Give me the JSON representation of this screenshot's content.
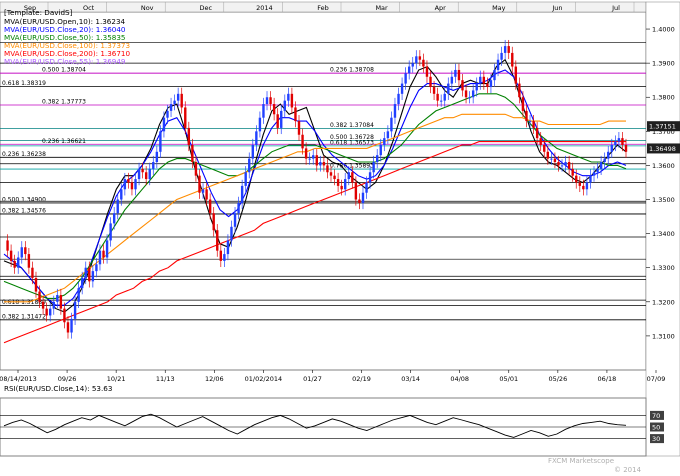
{
  "header": {
    "template": "[Template: DavidS]",
    "indicators": [
      {
        "label": "MVA(EUR/USD.Open,10): 1.36234",
        "color": "#000000"
      },
      {
        "label": "MVA(EUR/USD.Close,20): 1.36040",
        "color": "#0000ff"
      },
      {
        "label": "MVA(EUR/USD.Close,50): 1.35835",
        "color": "#008000"
      },
      {
        "label": "MVA(EUR/USD.Close,100): 1.37373",
        "color": "#ff8c00"
      },
      {
        "label": "MVA(EUR/USD.Close,200): 1.36710",
        "color": "#ff0000"
      },
      {
        "label": "MVA(EUR/USD.Close,55): 1.36949",
        "color": "#c080ff"
      }
    ]
  },
  "chart_data": {
    "type": "line",
    "title": "",
    "instrument": "EUR/USD",
    "top_labels": [
      "Sep",
      "Oct",
      "Nov",
      "Dec",
      "2014",
      "Feb",
      "Mar",
      "Apr",
      "May",
      "Jun",
      "Jul"
    ],
    "x_labels": [
      "08/14/2013",
      "09/26",
      "10/21",
      "11/13",
      "12/06",
      "01/02/2014",
      "01/27",
      "02/19",
      "03/14",
      "04/08",
      "05/01",
      "05/26",
      "06/18",
      "07/09"
    ],
    "ylim": [
      1.3,
      1.405
    ],
    "yticks": [
      "1.4000",
      "1.3900",
      "1.3800",
      "1.3700",
      "1.3600",
      "1.3500",
      "1.3400",
      "1.3300",
      "1.3200",
      "1.3100"
    ],
    "price_series": [
      1.338,
      1.335,
      1.332,
      1.33,
      1.333,
      1.336,
      1.334,
      1.33,
      1.327,
      1.323,
      1.32,
      1.318,
      1.316,
      1.318,
      1.32,
      1.322,
      1.318,
      1.314,
      1.311,
      1.315,
      1.32,
      1.324,
      1.327,
      1.33,
      1.326,
      1.329,
      1.331,
      1.335,
      1.333,
      1.338,
      1.343,
      1.346,
      1.35,
      1.353,
      1.356,
      1.355,
      1.353,
      1.356,
      1.359,
      1.358,
      1.356,
      1.359,
      1.361,
      1.364,
      1.37,
      1.374,
      1.376,
      1.378,
      1.379,
      1.381,
      1.377,
      1.371,
      1.366,
      1.361,
      1.357,
      1.352,
      1.353,
      1.35,
      1.346,
      1.341,
      1.335,
      1.332,
      1.334,
      1.338,
      1.342,
      1.346,
      1.349,
      1.354,
      1.358,
      1.362,
      1.366,
      1.37,
      1.374,
      1.378,
      1.38,
      1.378,
      1.375,
      1.371,
      1.376,
      1.379,
      1.381,
      1.377,
      1.373,
      1.369,
      1.365,
      1.362,
      1.362,
      1.363,
      1.36,
      1.361,
      1.36,
      1.358,
      1.357,
      1.356,
      1.354,
      1.353,
      1.356,
      1.358,
      1.355,
      1.35,
      1.349,
      1.352,
      1.355,
      1.358,
      1.361,
      1.363,
      1.366,
      1.368,
      1.37,
      1.374,
      1.378,
      1.381,
      1.384,
      1.387,
      1.389,
      1.39,
      1.392,
      1.391,
      1.389,
      1.386,
      1.383,
      1.381,
      1.379,
      1.379,
      1.381,
      1.384,
      1.386,
      1.388,
      1.385,
      1.382,
      1.38,
      1.38,
      1.382,
      1.384,
      1.386,
      1.384,
      1.383,
      1.385,
      1.388,
      1.391,
      1.393,
      1.395,
      1.393,
      1.389,
      1.384,
      1.38,
      1.376,
      1.373,
      1.373,
      1.371,
      1.368,
      1.366,
      1.364,
      1.362,
      1.362,
      1.361,
      1.36,
      1.36,
      1.361,
      1.359,
      1.357,
      1.355,
      1.354,
      1.353,
      1.355,
      1.357,
      1.358,
      1.359,
      1.361,
      1.362,
      1.364,
      1.366,
      1.367,
      1.368,
      1.366,
      1.364
    ],
    "series": [
      {
        "name": "MVA(EUR/USD.Open,10)",
        "color": "#000000",
        "values": [
          1.332,
          1.331,
          1.33,
          1.327,
          1.324,
          1.321,
          1.318,
          1.317,
          1.319,
          1.324,
          1.33,
          1.338,
          1.346,
          1.353,
          1.357,
          1.357,
          1.36,
          1.365,
          1.372,
          1.377,
          1.378,
          1.37,
          1.36,
          1.352,
          1.344,
          1.337,
          1.336,
          1.342,
          1.35,
          1.36,
          1.369,
          1.376,
          1.378,
          1.375,
          1.376,
          1.377,
          1.37,
          1.363,
          1.361,
          1.36,
          1.357,
          1.355,
          1.353,
          1.355,
          1.36,
          1.367,
          1.375,
          1.383,
          1.388,
          1.389,
          1.386,
          1.382,
          1.38,
          1.384,
          1.385,
          1.384,
          1.384,
          1.389,
          1.391,
          1.386,
          1.378,
          1.37,
          1.364,
          1.361,
          1.36,
          1.358,
          1.356,
          1.355,
          1.357,
          1.36,
          1.363,
          1.366,
          1.364
        ]
      },
      {
        "name": "MVA(EUR/USD.Close,20)",
        "color": "#0000ff",
        "values": [
          1.334,
          1.332,
          1.33,
          1.327,
          1.324,
          1.321,
          1.319,
          1.319,
          1.321,
          1.325,
          1.331,
          1.338,
          1.345,
          1.351,
          1.355,
          1.357,
          1.36,
          1.364,
          1.369,
          1.373,
          1.374,
          1.37,
          1.364,
          1.358,
          1.352,
          1.347,
          1.345,
          1.347,
          1.352,
          1.359,
          1.366,
          1.371,
          1.374,
          1.374,
          1.373,
          1.373,
          1.37,
          1.366,
          1.363,
          1.361,
          1.359,
          1.357,
          1.356,
          1.357,
          1.36,
          1.365,
          1.371,
          1.377,
          1.382,
          1.384,
          1.384,
          1.383,
          1.382,
          1.383,
          1.384,
          1.384,
          1.385,
          1.387,
          1.388,
          1.386,
          1.381,
          1.375,
          1.369,
          1.365,
          1.362,
          1.36,
          1.358,
          1.357,
          1.357,
          1.358,
          1.36,
          1.361,
          1.36
        ]
      },
      {
        "name": "MVA(EUR/USD.Close,50)",
        "color": "#008000",
        "values": [
          1.326,
          1.325,
          1.324,
          1.323,
          1.322,
          1.321,
          1.321,
          1.322,
          1.324,
          1.327,
          1.331,
          1.335,
          1.339,
          1.343,
          1.347,
          1.35,
          1.353,
          1.356,
          1.359,
          1.361,
          1.362,
          1.362,
          1.361,
          1.36,
          1.359,
          1.358,
          1.357,
          1.357,
          1.358,
          1.36,
          1.362,
          1.364,
          1.365,
          1.366,
          1.366,
          1.366,
          1.366,
          1.365,
          1.364,
          1.363,
          1.362,
          1.361,
          1.361,
          1.361,
          1.362,
          1.364,
          1.366,
          1.369,
          1.372,
          1.374,
          1.376,
          1.377,
          1.378,
          1.379,
          1.38,
          1.381,
          1.381,
          1.381,
          1.38,
          1.378,
          1.375,
          1.372,
          1.369,
          1.367,
          1.365,
          1.364,
          1.363,
          1.362,
          1.361,
          1.361,
          1.36,
          1.36,
          1.359
        ]
      },
      {
        "name": "MVA(EUR/USD.Close,100)",
        "color": "#ff8c00",
        "values": [
          1.32,
          1.32,
          1.32,
          1.32,
          1.321,
          1.322,
          1.323,
          1.324,
          1.326,
          1.328,
          1.33,
          1.332,
          1.334,
          1.336,
          1.338,
          1.34,
          1.342,
          1.344,
          1.346,
          1.348,
          1.35,
          1.351,
          1.352,
          1.353,
          1.354,
          1.355,
          1.356,
          1.357,
          1.358,
          1.359,
          1.36,
          1.361,
          1.362,
          1.363,
          1.364,
          1.364,
          1.365,
          1.365,
          1.365,
          1.365,
          1.365,
          1.365,
          1.365,
          1.366,
          1.367,
          1.368,
          1.369,
          1.37,
          1.371,
          1.372,
          1.373,
          1.374,
          1.374,
          1.375,
          1.375,
          1.375,
          1.375,
          1.375,
          1.375,
          1.374,
          1.374,
          1.373,
          1.373,
          1.372,
          1.372,
          1.372,
          1.372,
          1.372,
          1.372,
          1.372,
          1.373,
          1.373,
          1.373
        ]
      },
      {
        "name": "MVA(EUR/USD.Close,200)",
        "color": "#ff0000",
        "values": [
          1.308,
          1.309,
          1.31,
          1.311,
          1.312,
          1.313,
          1.314,
          1.315,
          1.316,
          1.317,
          1.318,
          1.319,
          1.32,
          1.322,
          1.323,
          1.324,
          1.326,
          1.327,
          1.329,
          1.33,
          1.332,
          1.333,
          1.334,
          1.335,
          1.336,
          1.337,
          1.338,
          1.339,
          1.34,
          1.341,
          1.343,
          1.344,
          1.345,
          1.346,
          1.347,
          1.348,
          1.349,
          1.35,
          1.351,
          1.352,
          1.353,
          1.354,
          1.355,
          1.356,
          1.357,
          1.358,
          1.359,
          1.36,
          1.361,
          1.362,
          1.363,
          1.364,
          1.365,
          1.366,
          1.366,
          1.367,
          1.367,
          1.367,
          1.367,
          1.367,
          1.367,
          1.367,
          1.367,
          1.367,
          1.367,
          1.367,
          1.367,
          1.367,
          1.367,
          1.367,
          1.367,
          1.367,
          1.367
        ]
      }
    ],
    "levels": [
      {
        "label": "0.618 1.38319",
        "value": 1.38319,
        "color": "#000000"
      },
      {
        "label": "0.500 1.38704",
        "value": 1.38704,
        "color": "#c000c0"
      },
      {
        "label": "0.382 1.37773",
        "value": 1.37773,
        "color": "#c000c0"
      },
      {
        "label": "0.236 1.38708",
        "value": 1.38708,
        "color": "#c000c0"
      },
      {
        "label": "0.382 1.37084",
        "value": 1.37084,
        "color": "#008080"
      },
      {
        "label": "0.500 1.36728",
        "value": 1.36728,
        "color": "#008080"
      },
      {
        "label": "0.236 1.36621",
        "value": 1.36621,
        "color": "#c000c0"
      },
      {
        "label": "0.236 1.36238",
        "value": 1.36238,
        "color": "#000000"
      },
      {
        "label": "0.618 1.36573",
        "value": 1.36573,
        "color": "#00a0a0"
      },
      {
        "label": "0.786 1.35893",
        "value": 1.35893,
        "color": "#00a0a0"
      },
      {
        "label": "0.500 1.34900",
        "value": 1.349,
        "color": "#000000"
      },
      {
        "label": "0.382 1.34576",
        "value": 1.34576,
        "color": "#000000"
      },
      {
        "label": "0.618 1.31889",
        "value": 1.31889,
        "color": "#000000"
      },
      {
        "label": "0.382 1.31472",
        "value": 1.31472,
        "color": "#000000"
      }
    ],
    "plain_levels": [
      1.396,
      1.39,
      1.3605,
      1.355,
      1.3495,
      1.3458,
      1.339,
      1.3325,
      1.3275,
      1.3265,
      1.3205
    ],
    "price_tags": [
      {
        "label": "1.37151",
        "value": 1.37151
      },
      {
        "label": "1.36498",
        "value": 1.36498
      }
    ],
    "watermark": "FXCM Marketscope",
    "rsi": {
      "label": "RSI(EUR/USD.Close,14): 53.63",
      "levels": [
        "70",
        "50",
        "30"
      ],
      "values": [
        52,
        58,
        62,
        56,
        48,
        40,
        46,
        54,
        60,
        66,
        62,
        70,
        64,
        58,
        52,
        60,
        68,
        72,
        66,
        58,
        50,
        56,
        62,
        68,
        60,
        52,
        44,
        38,
        46,
        54,
        60,
        66,
        70,
        64,
        56,
        48,
        52,
        58,
        64,
        60,
        54,
        48,
        44,
        50,
        56,
        62,
        66,
        70,
        64,
        58,
        54,
        60,
        66,
        62,
        58,
        54,
        48,
        42,
        36,
        32,
        38,
        44,
        40,
        34,
        38,
        46,
        52,
        56,
        58,
        60,
        56,
        54,
        53
      ]
    }
  },
  "footer": {
    "copyright": "© 2014"
  }
}
